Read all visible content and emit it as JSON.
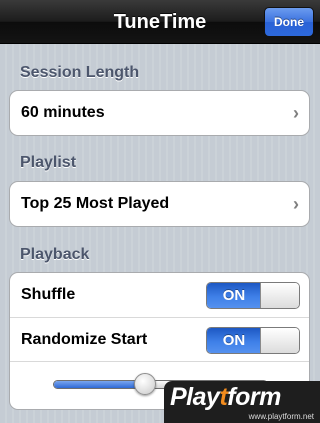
{
  "navbar": {
    "title": "TuneTime",
    "done_label": "Done"
  },
  "sections": {
    "session_length": {
      "header": "Session Length",
      "value": "60 minutes"
    },
    "playlist": {
      "header": "Playlist",
      "value": "Top 25 Most Played"
    },
    "playback": {
      "header": "Playback",
      "shuffle": {
        "label": "Shuffle",
        "toggle_text": "ON"
      },
      "randomize_start": {
        "label": "Randomize Start",
        "toggle_text": "ON"
      },
      "slider_fraction": 0.43
    }
  },
  "icons": {
    "disclosure": "chevron-right-icon"
  },
  "colors": {
    "accent": "#3b72df",
    "section_header": "#4c566c"
  },
  "watermark": {
    "logo_prefix": "Play",
    "logo_accent": "t",
    "logo_suffix": "form",
    "url": "www.playtform.net"
  }
}
